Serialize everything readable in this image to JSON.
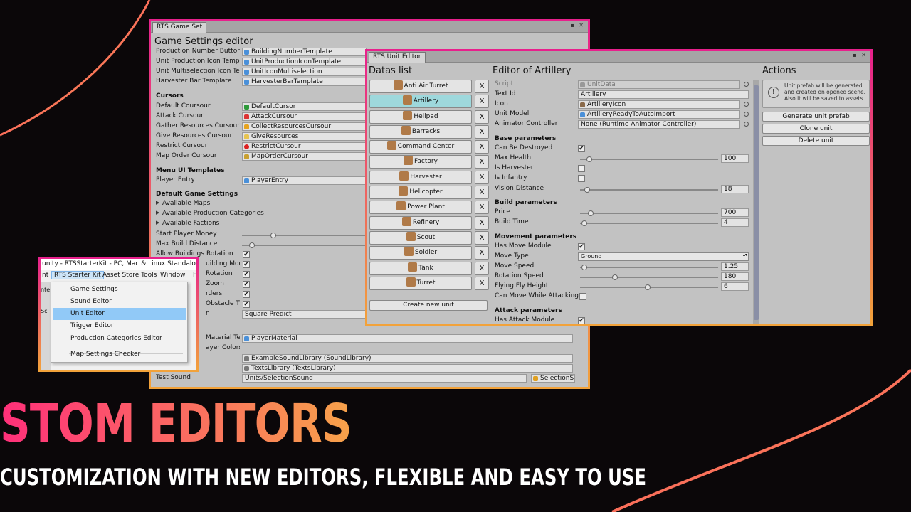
{
  "colors": {
    "accent": "#e8208c",
    "accent2": "#f2a23a",
    "title_gradient_start": "#ff2f7a",
    "title_gradient_end": "#f7a24a"
  },
  "game_settings": {
    "tab": "RTS Game Set",
    "title": "Game Settings editor",
    "rows": [
      {
        "label": "Production Number Buttor",
        "value": "BuildingNumberTemplate"
      },
      {
        "label": "Unit Production Icon Temp",
        "value": "UnitProductionIconTemplate"
      },
      {
        "label": "Unit Multiselection Icon Te",
        "value": "UnitIconMultiselection"
      },
      {
        "label": "Harvester Bar Template",
        "value": "HarvesterBarTemplate"
      }
    ],
    "cursors_header": "Cursors",
    "cursors": [
      {
        "label": "Default Coursour",
        "value": "DefaultCursor"
      },
      {
        "label": "Attack Cursour",
        "value": "AttackCursour"
      },
      {
        "label": "Gather Resources Cursour",
        "value": "CollectResourcesCursour"
      },
      {
        "label": "Give Resources Cursour",
        "value": "GiveResources"
      },
      {
        "label": "Restrict Cursour",
        "value": "RestrictCursour"
      },
      {
        "label": "Map Order Cursour",
        "value": "MapOrderCursour"
      }
    ],
    "menu_ui_header": "Menu UI Templates",
    "player_entry_label": "Player Entry",
    "player_entry_value": "PlayerEntry",
    "default_game_header": "Default Game Settings",
    "foldouts": [
      "Available Maps",
      "Available Production Categories",
      "Available Factions"
    ],
    "start_money_label": "Start Player Money",
    "max_build_label": "Max Build Distance",
    "allow_rotation_label": "Allow Buildings Rotation",
    "partial_labels": [
      "uilding Mod",
      "Rotation",
      "Zoom",
      "rders",
      "Obstacle T",
      "n"
    ],
    "square_predict": "Square Predict",
    "material_label": "Material Tem",
    "material_value": "PlayerMaterial",
    "player_colors_label": "ayer Colors",
    "sound_library": "ExampleSoundLibrary (SoundLibrary)",
    "texts_library": "TextsLibrary (TextsLibrary)",
    "test_sound_label": "Test Sound",
    "test_sound_value": "Units/SelectionSound",
    "selection_btn": "SelectionS"
  },
  "unit_editor": {
    "tab": "RTS Unit Editor",
    "datas_header": "Datas list",
    "editor_header": "Editor of Artillery",
    "actions_header": "Actions",
    "units": [
      "Anti Air Turret",
      "Artillery",
      "Helipad",
      "Barracks",
      "Command Center",
      "Factory",
      "Harvester",
      "Helicopter",
      "Power Plant",
      "Refinery",
      "Scout",
      "Soldier",
      "Tank",
      "Turret"
    ],
    "selected_index": 1,
    "remove_glyph": "X",
    "create_new": "Create new unit",
    "fields": {
      "script_label": "Script",
      "script_value": "UnitData",
      "textid_label": "Text Id",
      "textid_value": "Artillery",
      "icon_label": "Icon",
      "icon_value": "ArtilleryIcon",
      "model_label": "Unit Model",
      "model_value": "ArtilleryReadyToAutoImport",
      "anim_label": "Animator Controller",
      "anim_value": "None (Runtime Animator Controller)",
      "base_header": "Base parameters",
      "can_destroy": "Can Be Destroyed",
      "max_health": "Max Health",
      "max_health_val": "100",
      "max_health_level": 0.05,
      "is_harvester": "Is Harvester",
      "is_infantry": "Is Infantry",
      "vision": "Vision Distance",
      "vision_val": "18",
      "vision_level": 0.03,
      "build_header": "Build parameters",
      "price": "Price",
      "price_val": "700",
      "price_level": 0.06,
      "build_time": "Build Time",
      "build_time_val": "4",
      "build_time_level": 0.01,
      "movement_header": "Movement parameters",
      "has_move": "Has Move Module",
      "move_type": "Move Type",
      "move_type_val": "Ground",
      "move_speed": "Move Speed",
      "move_speed_val": "1.25",
      "move_speed_level": 0.01,
      "rotation_speed": "Rotation Speed",
      "rotation_speed_val": "180",
      "rotation_speed_level": 0.24,
      "fly_height": "Flying Fly Height",
      "fly_height_val": "6",
      "fly_height_level": 0.49,
      "move_attack": "Can Move While Attacking",
      "attack_header": "Attack parameters",
      "has_attack": "Has Attack Module"
    },
    "help_text": "Unit prefab will be generated and created on opened scene. Also it will be saved to assets.",
    "help_icon": "!",
    "actions": [
      "Generate unit prefab",
      "Clone unit",
      "Delete unit"
    ]
  },
  "unity_menu": {
    "title": "unity - RTSStarterKit - PC, Mac & Linux Standalone*",
    "bar": [
      "nt",
      "RTS Starter Kit",
      "Asset Store Tools",
      "Window",
      "H"
    ],
    "items": [
      "Game Settings",
      "Sound Editor",
      "Unit Editor",
      "Trigger Editor",
      "Production Categories Editor",
      "Map Settings Checker"
    ],
    "selected": "Unit Editor",
    "side_partial": [
      "nte",
      "Sc"
    ]
  },
  "headline": "STOM EDITORS",
  "subline": "CUSTOMIZATION WITH NEW EDITORS, FLEXIBLE AND EASY TO USE"
}
